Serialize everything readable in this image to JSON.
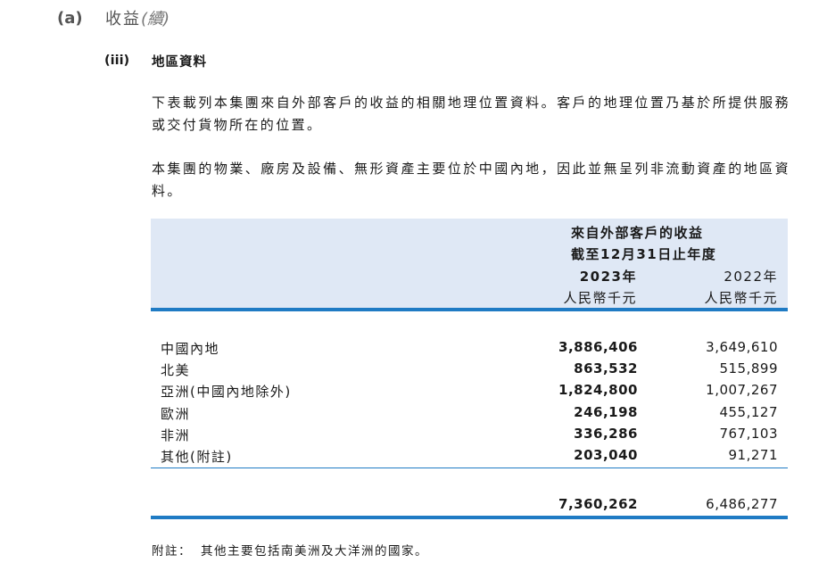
{
  "section": {
    "label": "(a)",
    "title": "收益",
    "continued": "(續)"
  },
  "subsection": {
    "label": "(iii)",
    "title": "地區資料"
  },
  "paragraphs": [
    "下表載列本集團來自外部客戶的收益的相關地理位置資料。客戶的地理位置乃基於所提供服務或交付貨物所在的位置。",
    "本集團的物業、廠房及設備、無形資產主要位於中國內地，因此並無呈列非流動資產的地區資料。"
  ],
  "table": {
    "header_line1": "來自外部客戶的收益",
    "header_line2": "截至12月31日止年度",
    "columns": [
      {
        "year": "2023年",
        "unit": "人民幣千元"
      },
      {
        "year": "2022年",
        "unit": "人民幣千元"
      }
    ],
    "rows": [
      {
        "region": "中國內地",
        "v2023": "3,886,406",
        "v2022": "3,649,610"
      },
      {
        "region": "北美",
        "v2023": "863,532",
        "v2022": "515,899"
      },
      {
        "region": "亞洲(中國內地除外)",
        "v2023": "1,824,800",
        "v2022": "1,007,267"
      },
      {
        "region": "歐洲",
        "v2023": "246,198",
        "v2022": "455,127"
      },
      {
        "region": "非洲",
        "v2023": "336,286",
        "v2022": "767,103"
      },
      {
        "region": "其他(附註)",
        "v2023": "203,040",
        "v2022": "91,271"
      }
    ],
    "total": {
      "v2023": "7,360,262",
      "v2022": "6,486,277"
    }
  },
  "footnote": {
    "label": "附註：",
    "text": "其他主要包括南美洲及大洋洲的國家。"
  },
  "colors": {
    "accent_rule": "#1f7bc4",
    "header_fill": "#dfe8f5"
  }
}
